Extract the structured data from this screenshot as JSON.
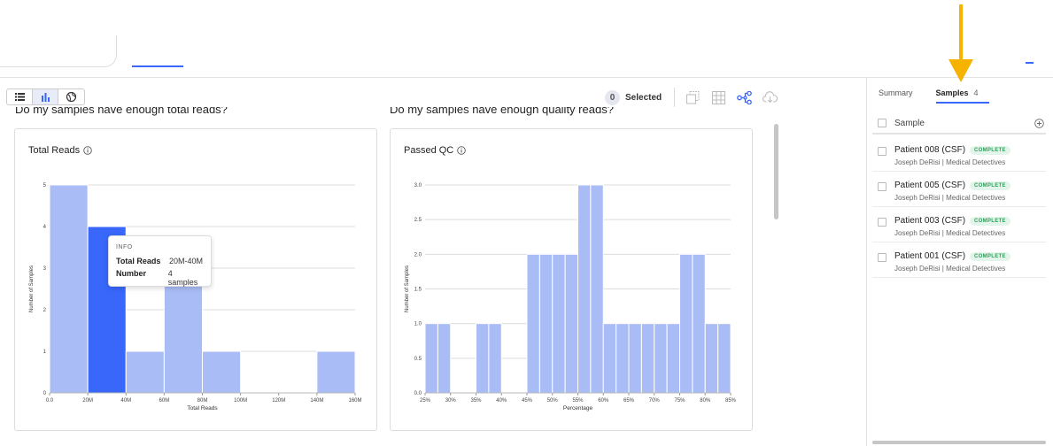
{
  "view_toggle": {
    "items": [
      "list-icon",
      "bar-chart-icon",
      "globe-icon"
    ],
    "active": "bar-chart-icon"
  },
  "toolbar": {
    "selected_count": "0",
    "selected_label": "Selected",
    "icons": [
      "copy-icon",
      "heatmap-icon",
      "phylo-tree-icon",
      "download-cloud-icon"
    ]
  },
  "headings": {
    "left": "Do my samples have enough total reads?",
    "right": "Do my samples have enough quality reads?"
  },
  "charts": {
    "total_reads": {
      "title": "Total Reads"
    },
    "passed_qc": {
      "title": "Passed QC"
    }
  },
  "tooltip": {
    "header": "INFO",
    "row1_key": "Total Reads",
    "row1_val": "20M-40M",
    "row2_key": "Number",
    "row2_val": "4 samples"
  },
  "sidebar": {
    "tabs": [
      {
        "label": "Summary"
      },
      {
        "label": "Samples",
        "count": "4"
      }
    ],
    "header_label": "Sample",
    "samples": [
      {
        "name": "Patient 008 (CSF)",
        "status": "COMPLETE",
        "meta": "Joseph DeRisi | Medical Detectives"
      },
      {
        "name": "Patient 005 (CSF)",
        "status": "COMPLETE",
        "meta": "Joseph DeRisi | Medical Detectives"
      },
      {
        "name": "Patient 003 (CSF)",
        "status": "COMPLETE",
        "meta": "Joseph DeRisi | Medical Detectives"
      },
      {
        "name": "Patient 001 (CSF)",
        "status": "COMPLETE",
        "meta": "Joseph DeRisi | Medical Detectives"
      }
    ]
  },
  "colors": {
    "bar": "#a9bcf5",
    "bar_highlight": "#3867fa",
    "accent": "#3867fa",
    "arrow": "#f5b300"
  },
  "chart_data": [
    {
      "type": "bar",
      "title": "Total Reads",
      "xlabel": "Total Reads",
      "ylabel": "Number of Samples",
      "x_ticks": [
        "0.0",
        "20M",
        "40M",
        "60M",
        "80M",
        "100M",
        "120M",
        "140M",
        "160M"
      ],
      "y_ticks": [
        "0",
        "1",
        "2",
        "3",
        "4",
        "5"
      ],
      "ylim": [
        0,
        5
      ],
      "bins": [
        {
          "range": "0-20M",
          "value": 5
        },
        {
          "range": "20M-40M",
          "value": 4,
          "highlighted": true
        },
        {
          "range": "40M-60M",
          "value": 1
        },
        {
          "range": "60M-80M",
          "value": 3
        },
        {
          "range": "80M-100M",
          "value": 1
        },
        {
          "range": "100M-120M",
          "value": 0
        },
        {
          "range": "120M-140M",
          "value": 0
        },
        {
          "range": "140M-160M",
          "value": 1
        }
      ],
      "grid": true
    },
    {
      "type": "bar",
      "title": "Passed QC",
      "xlabel": "Percentage",
      "ylabel": "Number of Samples",
      "x_ticks": [
        "25%",
        "30%",
        "35%",
        "40%",
        "45%",
        "50%",
        "55%",
        "60%",
        "65%",
        "70%",
        "75%",
        "80%",
        "85%"
      ],
      "y_ticks": [
        "0.0",
        "0.5",
        "1.0",
        "1.5",
        "2.0",
        "2.5",
        "3.0"
      ],
      "ylim": [
        0,
        3
      ],
      "bins": [
        {
          "range": "25-27.5%",
          "value": 1
        },
        {
          "range": "27.5-30%",
          "value": 1
        },
        {
          "range": "30-32.5%",
          "value": 0
        },
        {
          "range": "32.5-35%",
          "value": 0
        },
        {
          "range": "35-37.5%",
          "value": 1
        },
        {
          "range": "37.5-40%",
          "value": 1
        },
        {
          "range": "40-42.5%",
          "value": 0
        },
        {
          "range": "42.5-45%",
          "value": 0
        },
        {
          "range": "45-47.5%",
          "value": 2
        },
        {
          "range": "47.5-50%",
          "value": 2
        },
        {
          "range": "50-52.5%",
          "value": 2
        },
        {
          "range": "52.5-55%",
          "value": 2
        },
        {
          "range": "55-57.5%",
          "value": 3
        },
        {
          "range": "57.5-60%",
          "value": 3
        },
        {
          "range": "60-62.5%",
          "value": 1
        },
        {
          "range": "62.5-65%",
          "value": 1
        },
        {
          "range": "65-67.5%",
          "value": 1
        },
        {
          "range": "67.5-70%",
          "value": 1
        },
        {
          "range": "70-72.5%",
          "value": 1
        },
        {
          "range": "72.5-75%",
          "value": 1
        },
        {
          "range": "75-77.5%",
          "value": 2
        },
        {
          "range": "77.5-80%",
          "value": 2
        },
        {
          "range": "80-82.5%",
          "value": 1
        },
        {
          "range": "82.5-85%",
          "value": 1
        }
      ],
      "grid": true
    }
  ]
}
